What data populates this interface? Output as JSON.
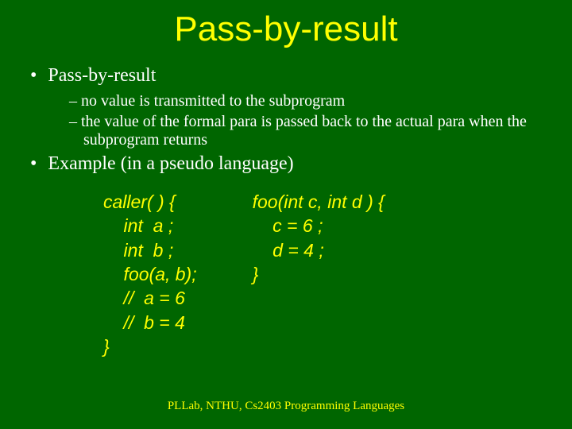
{
  "title": "Pass-by-result",
  "bullets": {
    "b1": "Pass-by-result",
    "b1_sub1": "no value is transmitted to the subprogram",
    "b1_sub2": "the value of the formal para is passed back to the actual para when the subprogram returns",
    "b2": "Example (in a pseudo language)"
  },
  "code_left": "caller( ) {\n    int  a ;\n    int  b ;\n    foo(a, b);\n    //  a = 6\n    //  b = 4\n}",
  "code_right": "foo(int c, int d ) {\n    c = 6 ;\n    d = 4 ;\n}",
  "footer": "PLLab, NTHU, Cs2403 Programming Languages"
}
